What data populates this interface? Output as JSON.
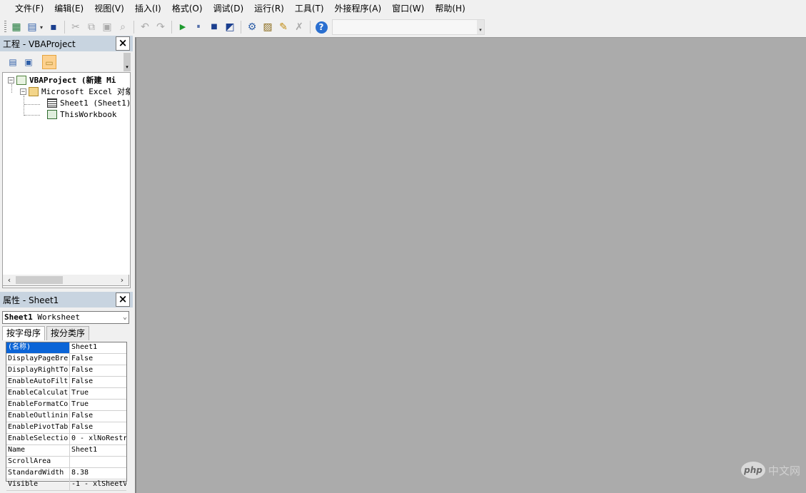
{
  "menu": [
    "文件(F)",
    "编辑(E)",
    "视图(V)",
    "插入(I)",
    "格式(O)",
    "调试(D)",
    "运行(R)",
    "工具(T)",
    "外接程序(A)",
    "窗口(W)",
    "帮助(H)"
  ],
  "toolbar": {
    "icons": {
      "excel": "▦",
      "insert": "▤",
      "save": "▪",
      "cut": "✂",
      "copy": "⧉",
      "paste": "▣",
      "find": "⌕",
      "undo": "↶",
      "redo": "↷",
      "run": "▶",
      "pause": "⏸",
      "stop": "■",
      "design": "◩",
      "project": "⚙",
      "properties": "▨",
      "objbrowser": "✎",
      "toolbox": "✗",
      "help": "?"
    },
    "dropdown_glyph": "▾",
    "combo_arrow": "▾"
  },
  "project_panel": {
    "title": "工程 - VBAProject",
    "close": "×",
    "buttons": {
      "view_code": "▤",
      "view_object": "▣",
      "toggle_folders": "▭"
    },
    "tree": {
      "root": "VBAProject (新建 Mi",
      "folder": "Microsoft Excel 对象",
      "items": [
        "Sheet1 (Sheet1)",
        "ThisWorkbook"
      ],
      "expander": "−"
    },
    "scroll": {
      "left": "‹",
      "right": "›"
    }
  },
  "properties_panel": {
    "title": "属性 - Sheet1",
    "close": "×",
    "object_name": "Sheet1",
    "object_type": "Worksheet",
    "combo_arrow": "⌄",
    "tabs": [
      "按字母序",
      "按分类序"
    ],
    "rows": [
      {
        "name": "(名称)",
        "value": "Sheet1"
      },
      {
        "name": "DisplayPageBre",
        "value": "False"
      },
      {
        "name": "DisplayRightTo",
        "value": "False"
      },
      {
        "name": "EnableAutoFilt",
        "value": "False"
      },
      {
        "name": "EnableCalculat",
        "value": "True"
      },
      {
        "name": "EnableFormatCo",
        "value": "True"
      },
      {
        "name": "EnableOutlinin",
        "value": "False"
      },
      {
        "name": "EnablePivotTab",
        "value": "False"
      },
      {
        "name": "EnableSelectio",
        "value": "0 - xlNoRestr"
      },
      {
        "name": "Name",
        "value": "Sheet1"
      },
      {
        "name": "ScrollArea",
        "value": ""
      },
      {
        "name": "StandardWidth",
        "value": "8.38"
      },
      {
        "name": "Visible",
        "value": "-1 - xlSheetV"
      }
    ]
  },
  "watermark": {
    "logo": "php",
    "text": "中文网"
  }
}
